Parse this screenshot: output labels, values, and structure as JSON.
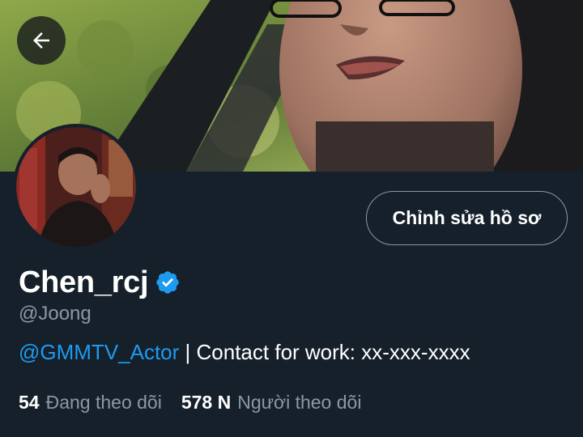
{
  "header": {
    "back_icon": "arrow-left-icon"
  },
  "profile": {
    "display_name": "Chen_rcj",
    "verified_icon": "verified-badge-icon",
    "handle": "@Joong",
    "edit_button_label": "Chỉnh sửa hồ sơ",
    "bio_mention": "@GMMTV_Actor",
    "bio_text": " | Contact for work: xx-xxx-xxxx"
  },
  "stats": {
    "following_count": "54",
    "following_label": "Đang theo dõi",
    "followers_count": "578 N",
    "followers_label": "Người theo dõi"
  },
  "colors": {
    "background": "#15202b",
    "accent": "#1d9bf0",
    "secondary_text": "#8b98a5"
  }
}
